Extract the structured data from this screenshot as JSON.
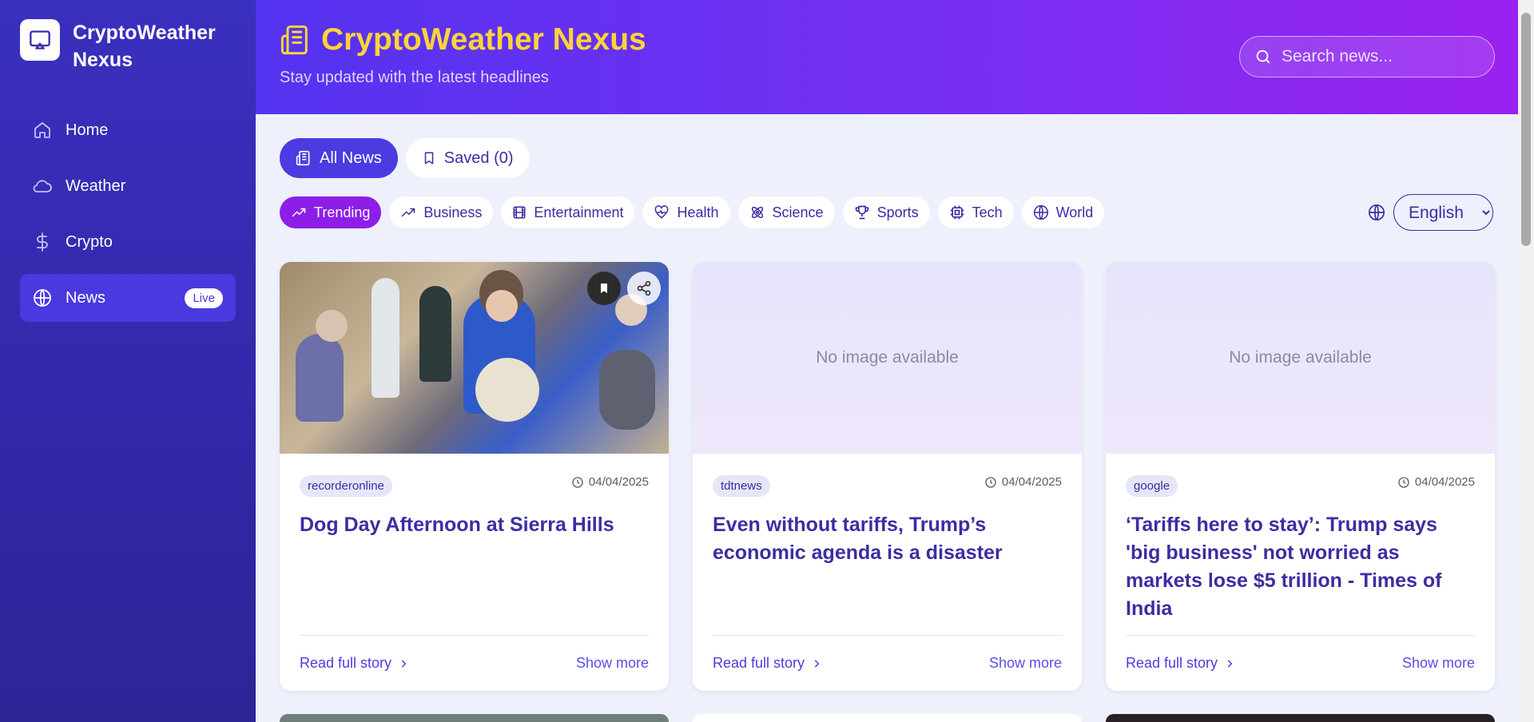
{
  "sidebar": {
    "brand": "CryptoWeather Nexus",
    "items": [
      {
        "label": "Home",
        "icon": "home-icon"
      },
      {
        "label": "Weather",
        "icon": "cloud-icon"
      },
      {
        "label": "Crypto",
        "icon": "dollar-icon"
      },
      {
        "label": "News",
        "icon": "globe-icon",
        "badge": "Live",
        "active": true
      }
    ]
  },
  "header": {
    "title": "CryptoWeather Nexus",
    "subtitle": "Stay updated with the latest headlines",
    "search_placeholder": "Search news..."
  },
  "tabs": [
    {
      "label": "All News",
      "active": true
    },
    {
      "label": "Saved (0)"
    }
  ],
  "categories": [
    "Trending",
    "Business",
    "Entertainment",
    "Health",
    "Science",
    "Sports",
    "Tech",
    "World"
  ],
  "language": {
    "selected": "English"
  },
  "cards": [
    {
      "source": "recorderonline",
      "date": "04/04/2025",
      "title": "Dog Day Afternoon at Sierra Hills",
      "read_label": "Read full story",
      "more_label": "Show more"
    },
    {
      "source": "tdtnews",
      "date": "04/04/2025",
      "title": "Even without tariffs, Trump’s economic agenda is a disaster",
      "no_image": "No image available",
      "read_label": "Read full story",
      "more_label": "Show more"
    },
    {
      "source": "google",
      "date": "04/04/2025",
      "title": "‘Tariffs here to stay’: Trump says 'big business' not worried as markets lose $5 trillion - Times of India",
      "no_image": "No image available",
      "read_label": "Read full story",
      "more_label": "Show more"
    }
  ],
  "colors": {
    "accent": "#4b3be0",
    "title_yellow": "#fcd43a",
    "trending": "#8d1ee8"
  }
}
